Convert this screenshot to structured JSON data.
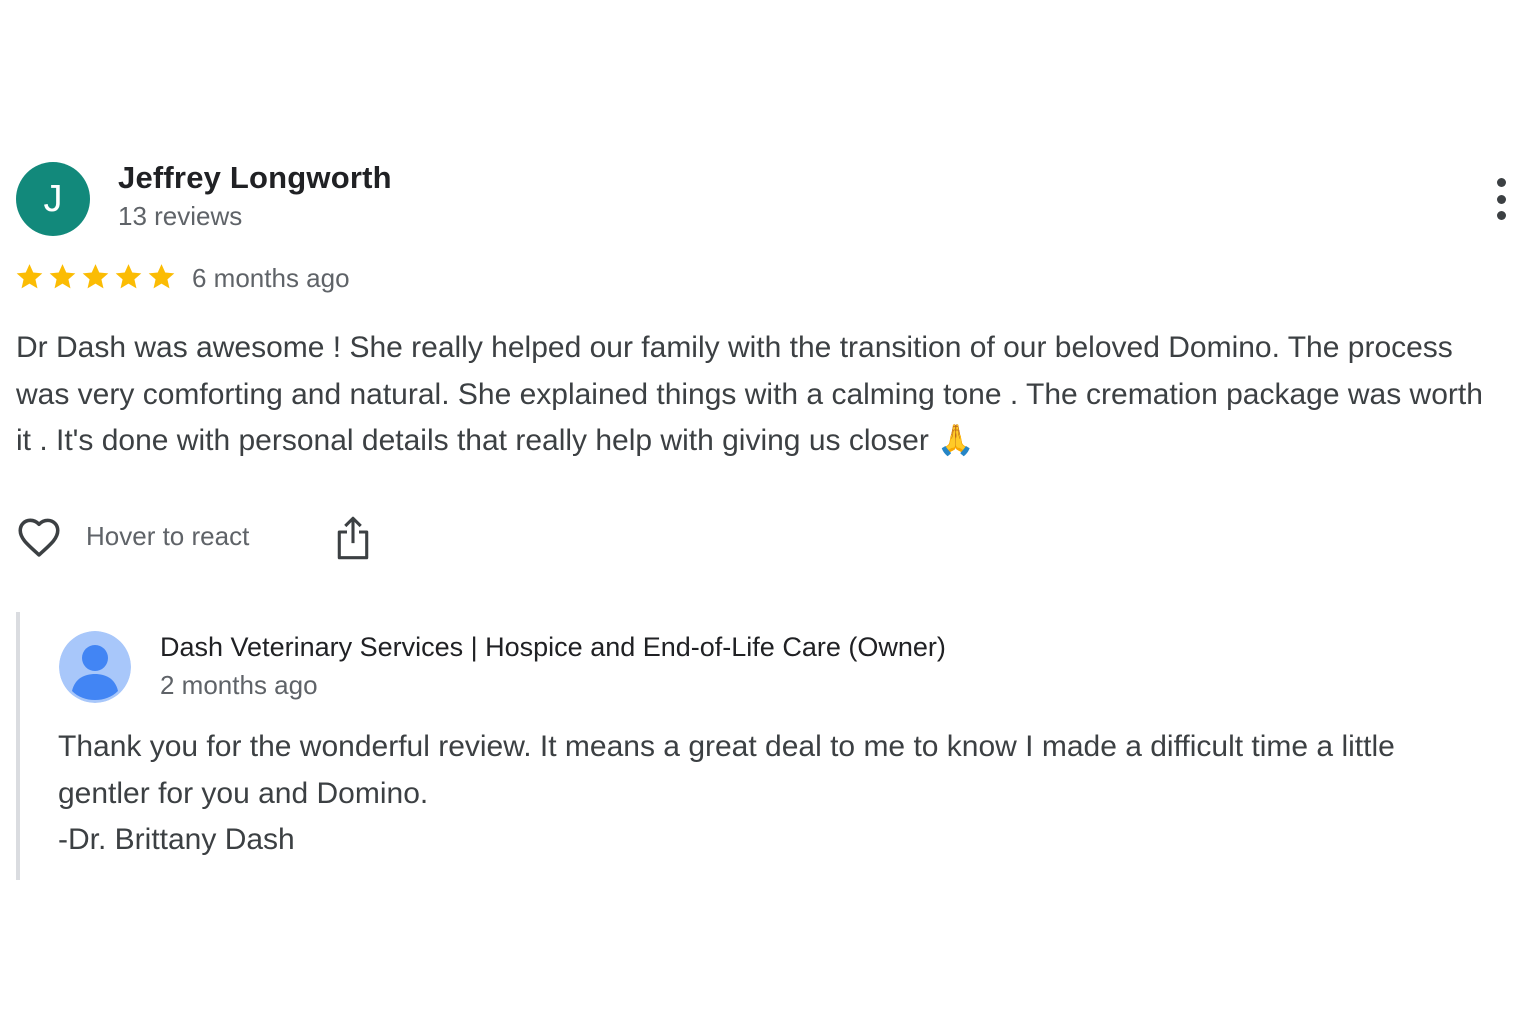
{
  "reviewer": {
    "initial": "J",
    "name": "Jeffrey Longworth",
    "reviews": "13 reviews",
    "avatar_color": "#12897b"
  },
  "rating": {
    "stars": 5,
    "max": 5,
    "color": "#fbbc04"
  },
  "review_date": "6 months ago",
  "review_text": "Dr Dash was awesome ! She really helped our family with the transition of our beloved Domino. The process was very comforting and natural. She explained things with a calming tone . The cremation package was worth it . It's done with personal details that really help with giving us closer 🙏",
  "actions": {
    "react_label": "Hover to react",
    "heart_icon": "heart-outline-icon",
    "share_icon": "share-icon",
    "more_icon": "more-vert-icon"
  },
  "owner_reply": {
    "name": "Dash Veterinary Services | Hospice and End-of-Life Care (Owner)",
    "date": "2 months ago",
    "lines": [
      "Thank you for the wonderful review. It means a great deal to me to know I made a difficult time a little",
      "gentler for you and Domino.",
      "-Dr. Brittany Dash"
    ],
    "avatar_icon": "default-profile-icon"
  }
}
